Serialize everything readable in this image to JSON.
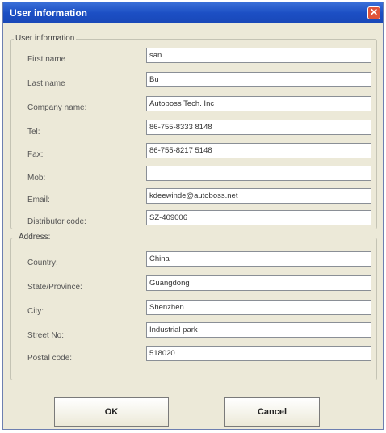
{
  "window": {
    "title": "User information",
    "close_glyph": "✕"
  },
  "user_info": {
    "group_title": "User information",
    "fields": [
      {
        "label": "First name",
        "value": "san"
      },
      {
        "label": "Last name",
        "value": "Bu"
      },
      {
        "label": "Company name:",
        "value": "Autoboss Tech. Inc"
      },
      {
        "label": "Tel:",
        "value": "86-755-8333 8148"
      },
      {
        "label": "Fax:",
        "value": "86-755-8217 5148"
      },
      {
        "label": "Mob:",
        "value": ""
      },
      {
        "label": "Email:",
        "value": "kdeewinde@autoboss.net"
      },
      {
        "label": "Distributor code:",
        "value": "SZ-409006"
      }
    ]
  },
  "address": {
    "group_title": "Address:",
    "fields": [
      {
        "label": "Country:",
        "value": "China"
      },
      {
        "label": "State/Province:",
        "value": "Guangdong"
      },
      {
        "label": "City:",
        "value": "Shenzhen"
      },
      {
        "label": "Street No:",
        "value": "Industrial park"
      },
      {
        "label": "Postal code:",
        "value": "518020"
      }
    ]
  },
  "buttons": {
    "ok_label": "OK",
    "cancel_label": "Cancel"
  }
}
